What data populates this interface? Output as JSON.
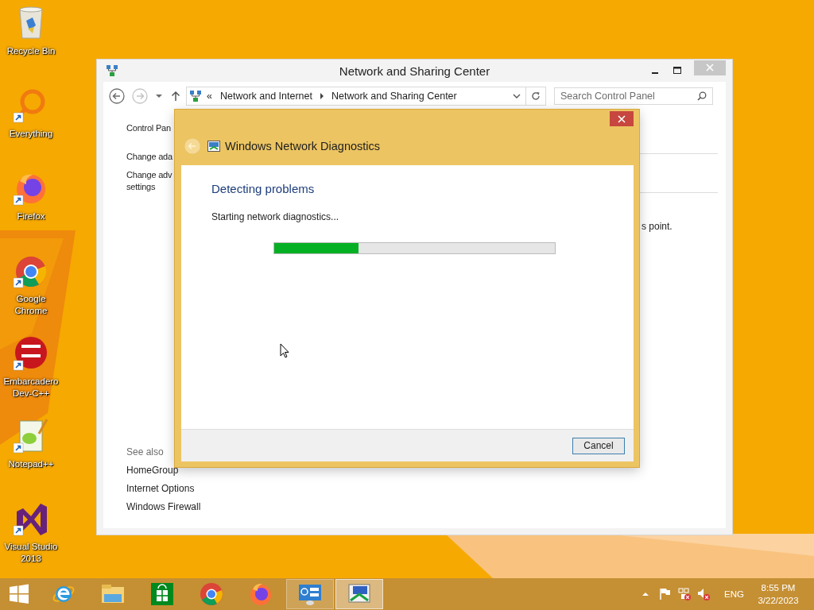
{
  "desktop": {
    "icons": [
      {
        "label": "Recycle Bin",
        "kind": "recycle",
        "shortcut": false
      },
      {
        "label": "Everything",
        "kind": "everything",
        "shortcut": true
      },
      {
        "label": "Firefox",
        "kind": "firefox",
        "shortcut": true
      },
      {
        "label": "Google Chrome",
        "kind": "chrome",
        "shortcut": true
      },
      {
        "label": "Embarcadero Dev-C++",
        "kind": "devcpp",
        "shortcut": true
      },
      {
        "label": "Notepad++",
        "kind": "notepad",
        "shortcut": true
      },
      {
        "label": "Visual Studio 2013",
        "kind": "vs",
        "shortcut": true
      }
    ]
  },
  "window": {
    "title": "Network and Sharing Center",
    "navigation": [
      {
        "kind": "back",
        "disabled": false
      },
      {
        "kind": "forward",
        "disabled": true
      }
    ],
    "address": {
      "overflow": "«",
      "breadcrumbs": [
        "Network and Internet",
        "Network and Sharing Center"
      ]
    },
    "search": {
      "placeholder": "Search Control Panel"
    },
    "sidebar": {
      "items": [
        {
          "lines": [
            "Control Pan"
          ]
        },
        {
          "lines": [
            "Change ada"
          ]
        },
        {
          "lines": [
            "Change adv",
            "settings"
          ]
        }
      ],
      "see_also": {
        "heading": "See also",
        "links": [
          "HomeGroup",
          "Internet Options",
          "Windows Firewall"
        ]
      }
    },
    "content_fragment": "s point."
  },
  "dialog": {
    "title": "Windows Network Diagnostics",
    "back_disabled": true,
    "heading": "Detecting problems",
    "status": "Starting network diagnostics...",
    "progress": {
      "level": 0.3
    },
    "buttons": [
      "Cancel"
    ]
  },
  "taskbar": {
    "apps": [
      {
        "kind": "ie",
        "running": false,
        "selected": false
      },
      {
        "kind": "explorer",
        "running": false,
        "selected": false
      },
      {
        "kind": "store",
        "running": false,
        "selected": false
      },
      {
        "kind": "chrome",
        "running": false,
        "selected": false
      },
      {
        "kind": "firefox",
        "running": false,
        "selected": false
      },
      {
        "kind": "controlpanel",
        "running": true,
        "selected": false
      },
      {
        "kind": "diagnostics",
        "running": true,
        "selected": true
      }
    ],
    "tray": [
      {
        "kind": "chevron",
        "alert": false
      },
      {
        "kind": "flag",
        "alert": false
      },
      {
        "kind": "network",
        "alert": true
      },
      {
        "kind": "volume",
        "alert": true
      }
    ],
    "language": "ENG",
    "time": "8:55 PM",
    "date": "3/22/2023"
  }
}
